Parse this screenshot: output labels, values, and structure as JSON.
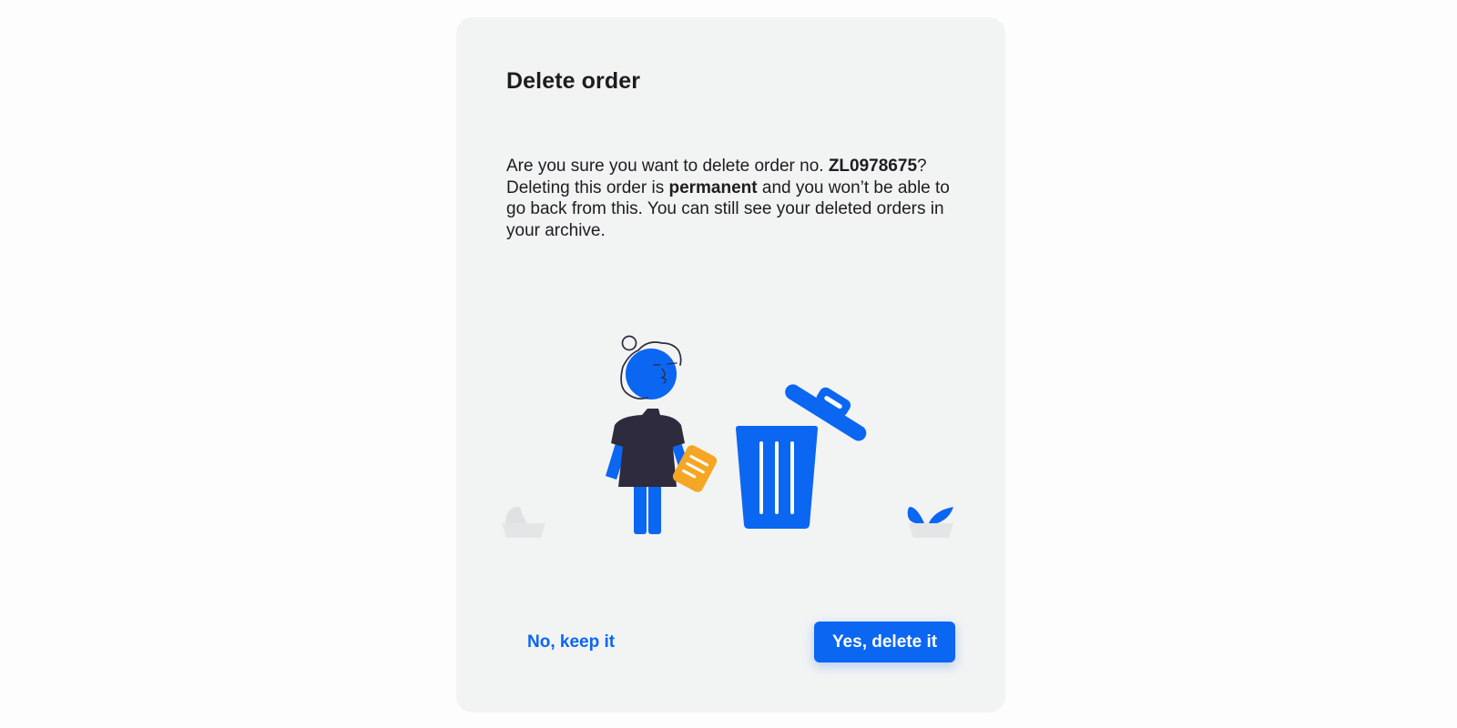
{
  "dialog": {
    "title": "Delete order",
    "message": {
      "intro": "Are you sure you want to delete order no. ",
      "order_number": "ZL0978675",
      "question_mark": "?",
      "line2_start": " Deleting this order is ",
      "emphasis": "permanent",
      "rest": " and you won’t be able to go back from this. You can still see your deleted orders in your archive."
    },
    "illustration": {
      "icon": "person-discarding-order-into-trash-illustration"
    },
    "buttons": {
      "cancel_label": "No, keep it",
      "confirm_label": "Yes, delete it"
    }
  },
  "colors": {
    "accent": "#0b66f2",
    "dialog_background": "#f2f3f3",
    "text": "#1d1d21",
    "paper": "#f5a623",
    "shirt": "#2d2b3d"
  }
}
